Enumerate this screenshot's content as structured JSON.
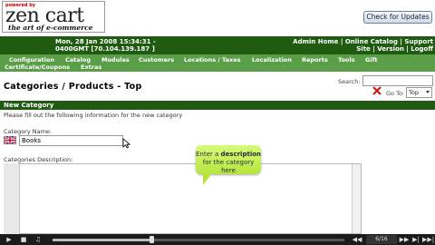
{
  "logo": {
    "powered": "powered by",
    "main": "zen cart",
    "tagline": "the art of e-commerce"
  },
  "update_button": "Check for Updates",
  "header": {
    "date_line1": "Mon, 28 Jan 2008 15:34:31 -",
    "date_line2": "0400GMT [70.104.139.187 ]",
    "links_line1": "Admin Home | Online Catalog | Support",
    "links_line2": "Site | Version | Logoff"
  },
  "menu": {
    "items": [
      "Configuration",
      "Catalog",
      "Modules",
      "Customers",
      "Locations / Taxes",
      "Localization",
      "Reports",
      "Tools",
      "Gift",
      "Certificate/Coupons",
      "Extras"
    ]
  },
  "page": {
    "title": "Categories / Products - Top",
    "search_label": "Search:",
    "search_value": "",
    "goto_label": "Go To:",
    "goto_value": "Top"
  },
  "form": {
    "section_title": "New Category",
    "instructions": "Please fill out the following information for the new category",
    "name_label": "Category Name:",
    "name_value": "Books",
    "desc_label": "Categories Description:"
  },
  "tooltip": {
    "line1_pre": "Enter a ",
    "line1_bold": "description",
    "line2": "for the category here"
  },
  "player": {
    "counter": "6/16",
    "progress": 0.34,
    "colors": {
      "accent": "#1f5c12",
      "menu": "#5a9e48",
      "tip": "#c6f05a"
    }
  }
}
